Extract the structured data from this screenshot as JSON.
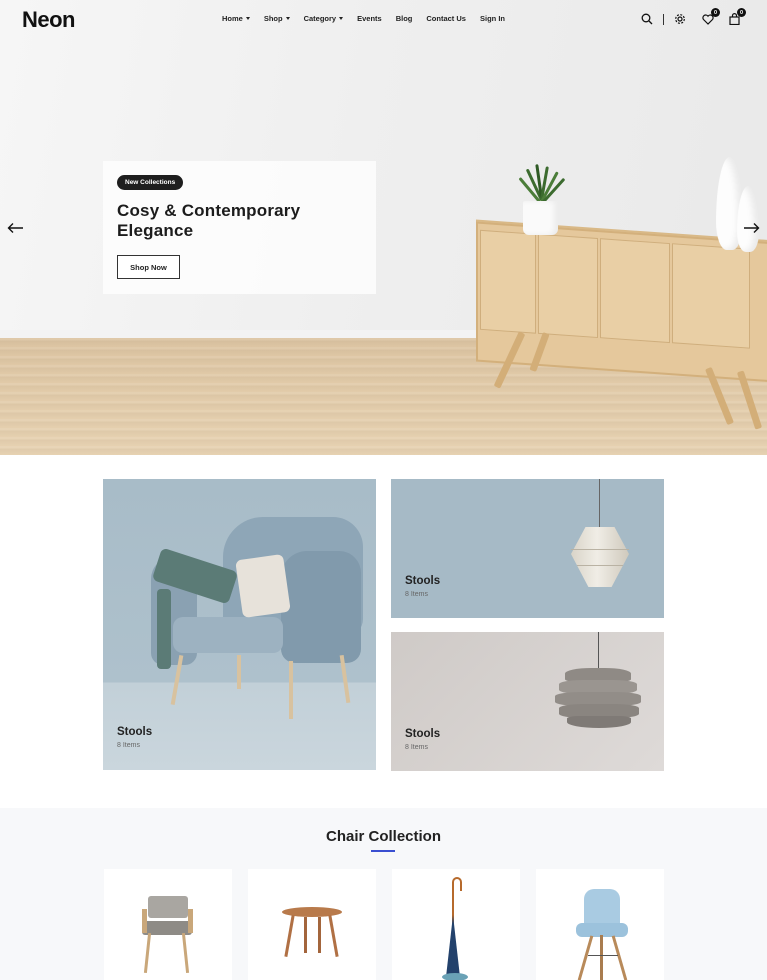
{
  "header": {
    "logo": "Neon",
    "nav": [
      {
        "label": "Home",
        "dropdown": true
      },
      {
        "label": "Shop",
        "dropdown": true
      },
      {
        "label": "Category",
        "dropdown": true
      },
      {
        "label": "Events",
        "dropdown": false
      },
      {
        "label": "Blog",
        "dropdown": false
      },
      {
        "label": "Contact Us",
        "dropdown": false
      },
      {
        "label": "Sign In",
        "dropdown": false
      }
    ],
    "icons": [
      "search-icon",
      "gear-icon",
      "heart-icon",
      "bag-icon"
    ],
    "wishlist_count": "0",
    "cart_count": "0"
  },
  "hero": {
    "badge": "New Collections",
    "title": "Cosy & Contemporary Elegance",
    "button": "Shop Now",
    "prev_icon": "arrow-left-icon",
    "next_icon": "arrow-right-icon"
  },
  "categories": [
    {
      "title": "Stools",
      "count": "8 Items"
    },
    {
      "title": "Stools",
      "count": "8 Items"
    },
    {
      "title": "Stools",
      "count": "8 Items"
    }
  ],
  "collection": {
    "title": "Chair Collection",
    "products": [
      "armchair-image",
      "round-table-image",
      "umbrella-stand-image",
      "eames-chair-image"
    ]
  },
  "colors": {
    "accent": "#3a4fd1",
    "dark": "#1e1e1e",
    "tile_blue": "#a6bac6",
    "tile_grey": "#d6d3d1"
  }
}
